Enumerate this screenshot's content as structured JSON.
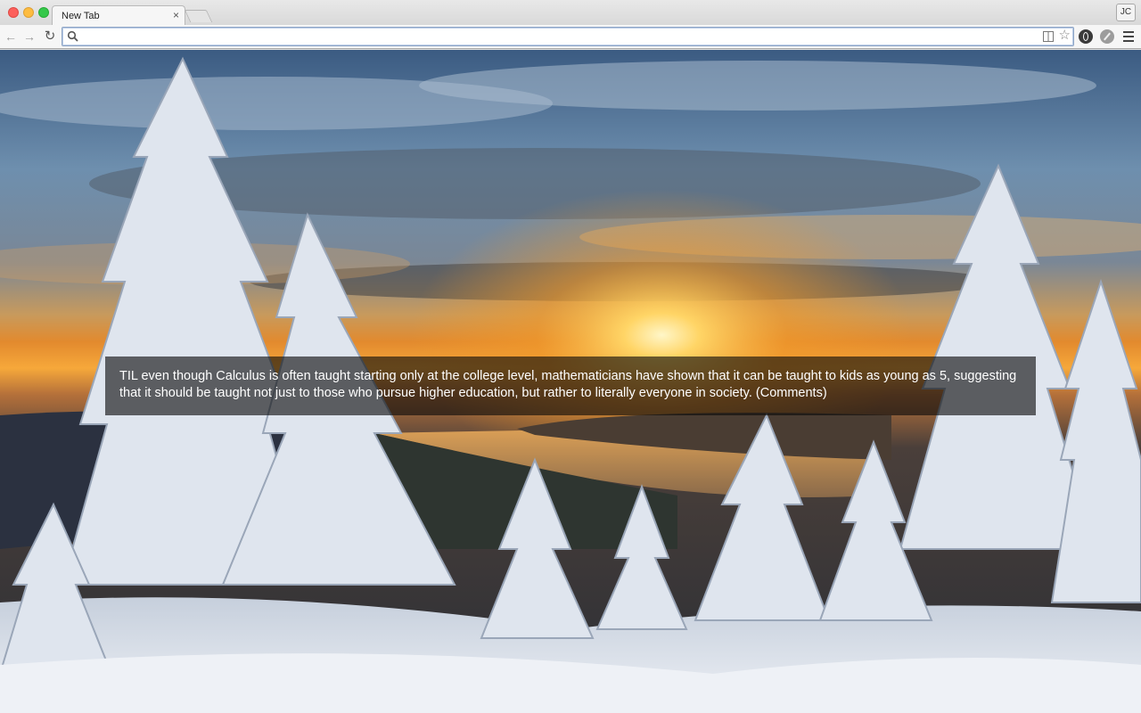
{
  "browser": {
    "tab_title": "New Tab",
    "tab_close": "×",
    "profile_initials": "JC",
    "omnibox_value": ""
  },
  "fact": {
    "text": "TIL even though Calculus is often taught starting only at the college level, mathematicians have shown that it can be taught to kids as young as 5, suggesting that it should be taught not just to those who pursue higher education, but rather to literally everyone in society.",
    "comments_link": "(Comments)"
  },
  "icons": {
    "back": "arrow-left-icon",
    "forward": "arrow-right-icon",
    "reload": "reload-icon",
    "search": "search-icon",
    "reader": "reader-mode-icon",
    "bookmark": "star-icon",
    "ext1": "opera-extension-icon",
    "ext2": "compass-extension-icon",
    "menu": "hamburger-menu-icon"
  },
  "colors": {
    "sky_top": "#3a5a80",
    "sunset": "#f5a623",
    "snow": "#eef1f5",
    "caption_bg": "#0a0a0a"
  }
}
